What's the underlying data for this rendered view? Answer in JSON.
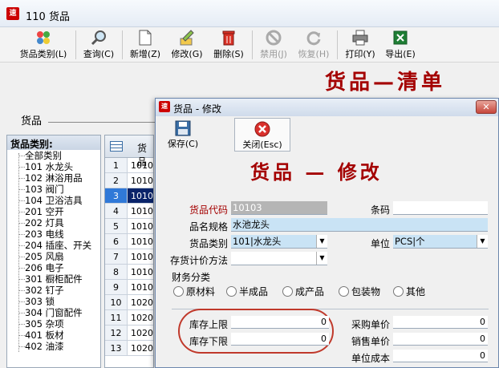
{
  "main": {
    "title": "110 货品",
    "logo": "速"
  },
  "toolbar": {
    "category": "货品类别(L)",
    "query": "查询(C)",
    "add": "新增(Z)",
    "edit": "修改(G)",
    "delete": "删除(S)",
    "disable": "禁用(J)",
    "restore": "恢复(H)",
    "print": "打印(Y)",
    "export": "导出(E)"
  },
  "list_title": "货品—清单",
  "filter_label": "货品",
  "category_panel": {
    "header": "货品类别:",
    "items": [
      "全部类别",
      "101 水龙头",
      "102 淋浴用品",
      "103 阀门",
      "104 卫浴洁具",
      "201 空开",
      "202 灯具",
      "203 电线",
      "204 插座、开关",
      "205 风扇",
      "206 电子",
      "301 橱柜配件",
      "302 钉子",
      "303 锁",
      "304 门窗配件",
      "305 杂项",
      "401 板材",
      "402 油漆"
    ]
  },
  "grid": {
    "header": "货品",
    "rows": [
      {
        "num": "1",
        "code": "1010"
      },
      {
        "num": "2",
        "code": "1010"
      },
      {
        "num": "3",
        "code": "1010"
      },
      {
        "num": "4",
        "code": "1010"
      },
      {
        "num": "5",
        "code": "1010"
      },
      {
        "num": "6",
        "code": "1010"
      },
      {
        "num": "7",
        "code": "1010"
      },
      {
        "num": "8",
        "code": "1010"
      },
      {
        "num": "9",
        "code": "1010"
      },
      {
        "num": "10",
        "code": "1020"
      },
      {
        "num": "11",
        "code": "1020"
      },
      {
        "num": "12",
        "code": "1020"
      },
      {
        "num": "13",
        "code": "1020"
      }
    ]
  },
  "dialog": {
    "title": "货品 - 修改",
    "close_x": "✕",
    "save": "保存(C)",
    "close": "关闭(Esc)",
    "heading": "货品 — 修改",
    "labels": {
      "code": "货品代码",
      "barcode": "条码",
      "spec": "品名规格",
      "category": "货品类别",
      "unit": "单位",
      "cost_method": "存货计价方法",
      "finance": "财务分类",
      "stock_max": "库存上限",
      "stock_min": "库存下限",
      "purchase_price": "采购单价",
      "sale_price": "销售单价",
      "unit_cost": "单位成本"
    },
    "values": {
      "code": "10103",
      "barcode": "",
      "spec": "水池龙头",
      "category": "101|水龙头",
      "unit": "PCS|个",
      "cost_method": "",
      "stock_max": "0",
      "stock_min": "0",
      "purchase_price": "0",
      "sale_price": "0",
      "unit_cost": "0"
    },
    "finance_options": [
      "原材料",
      "半成品",
      "成产品",
      "包装物",
      "其他"
    ]
  }
}
